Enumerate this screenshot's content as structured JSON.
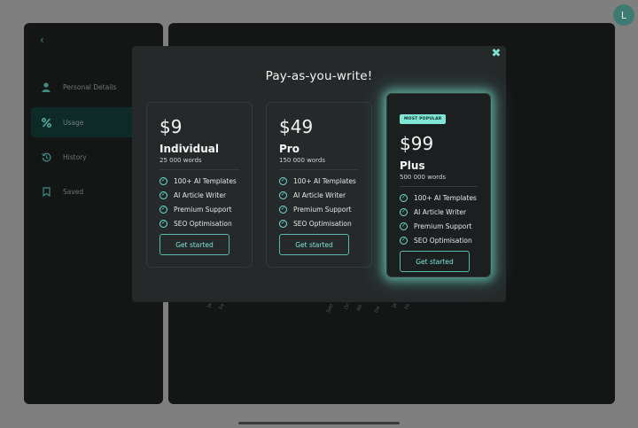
{
  "user": {
    "avatar_initial": "L"
  },
  "sidebar": {
    "back_icon": "chevron-left-icon",
    "items": [
      {
        "label": "Personal Details",
        "icon": "person-icon",
        "active": false
      },
      {
        "label": "Usage",
        "icon": "percent-icon",
        "active": true
      },
      {
        "label": "History",
        "icon": "history-icon",
        "active": false
      },
      {
        "label": "Saved",
        "icon": "bookmark-icon",
        "active": false
      }
    ]
  },
  "background_chart": {
    "tick_labels": [
      "Ja",
      "Fe",
      "Sep",
      "Oc",
      "No",
      "De",
      "Ja",
      "Fe"
    ]
  },
  "modal": {
    "title": "Pay-as-you-write!",
    "close_icon": "close-icon",
    "plans": [
      {
        "price": "$9",
        "name": "Individual",
        "words": "25 000 words",
        "features": [
          "100+ AI Templates",
          "AI Article Writer",
          "Premium Support",
          "SEO Optimisation"
        ],
        "cta": "Get started"
      },
      {
        "price": "$49",
        "name": "Pro",
        "words": "150 000 words",
        "features": [
          "100+ AI Templates",
          "AI Article Writer",
          "Premium Support",
          "SEO Optimisation"
        ],
        "cta": "Get started"
      },
      {
        "badge": "MOST POPULAR",
        "price": "$99",
        "name": "Plus",
        "words": "500 000 words",
        "features": [
          "100+ AI Templates",
          "AI Article Writer",
          "Premium Support",
          "SEO Optimisation"
        ],
        "cta": "Get started"
      }
    ]
  },
  "colors": {
    "accent": "#7fe6d6",
    "overlay": "#7f7f7f",
    "modal_bg": "#25292a",
    "panel_bg": "#141616"
  }
}
